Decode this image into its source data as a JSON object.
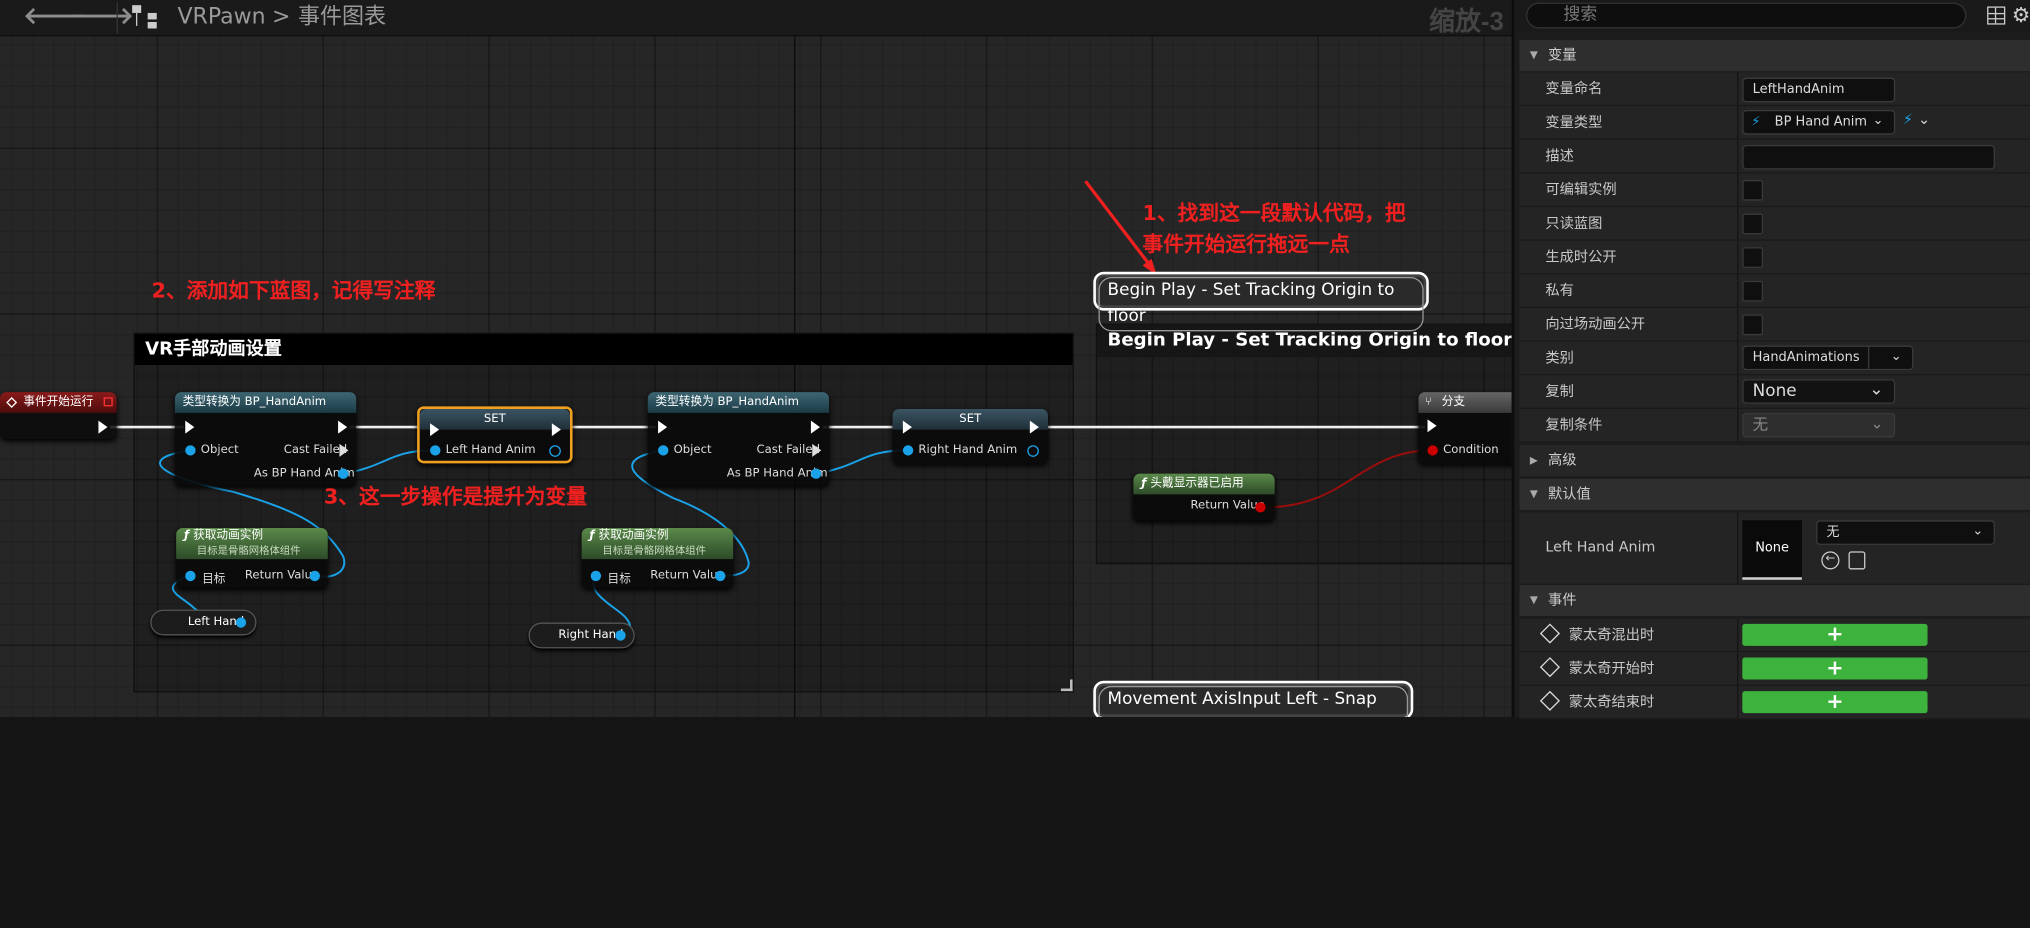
{
  "toolbar": {
    "back_icon": "left-arrow-icon",
    "forward_icon": "right-arrow-icon",
    "breadcrumb_root": "VRPawn",
    "breadcrumb_sep": ">",
    "breadcrumb_leaf": "事件图表",
    "zoom": "缩放-3"
  },
  "comments": {
    "hand_setup": "VR手部动画设置",
    "begin_play": "Begin Play - Set Tracking Origin to floor",
    "begin_play_bubble": "Begin Play - Set Tracking Origin to floor",
    "snap_turn_bubble": "Movement AxisInput Left - Snap Turn"
  },
  "nodes": {
    "event_begin": "事件开始运行",
    "cast1": {
      "title": "类型转换为 BP_HandAnim",
      "object": "Object",
      "cast_failed": "Cast Failed",
      "as": "As BP Hand Anim"
    },
    "set1": {
      "title": "SET",
      "pin": "Left Hand Anim"
    },
    "cast2": {
      "title": "类型转换为 BP_HandAnim",
      "object": "Object",
      "cast_failed": "Cast Failed",
      "as": "As BP Hand Anim"
    },
    "set2": {
      "title": "SET",
      "pin": "Right Hand Anim"
    },
    "func1": {
      "title": "获取动画实例",
      "subtitle": "目标是骨骼网格体组件",
      "target": "目标",
      "ret": "Return Value"
    },
    "func2": {
      "title": "获取动画实例",
      "subtitle": "目标是骨骼网格体组件",
      "target": "目标",
      "ret": "Return Value"
    },
    "left_hand": "Left Hand",
    "right_hand": "Right Hand",
    "hmd": {
      "title": "头戴显示器已启用",
      "ret": "Return Value"
    },
    "branch": {
      "title": "分支",
      "cond": "Condition"
    }
  },
  "annotations": {
    "a1_line1": "1、找到这一段默认代码，把",
    "a1_line2": "事件开始运行拖远一点",
    "a2": "2、添加如下蓝图，记得写注释",
    "a3": "3、这一步操作是提升为变量"
  },
  "panel": {
    "search_placeholder": "搜索",
    "sections": {
      "variables": "变量",
      "advanced": "高级",
      "defaults": "默认值",
      "events": "事件"
    },
    "rows": {
      "var_name": {
        "label": "变量命名",
        "value": "LeftHandAnim"
      },
      "var_type": {
        "label": "变量类型",
        "value": "BP Hand Anim"
      },
      "desc": {
        "label": "描述",
        "value": ""
      },
      "editable": {
        "label": "可编辑实例"
      },
      "readonly": {
        "label": "只读蓝图"
      },
      "expose_spawn": {
        "label": "生成时公开"
      },
      "private": {
        "label": "私有"
      },
      "expose_cine": {
        "label": "向过场动画公开"
      },
      "category": {
        "label": "类别",
        "value": "HandAnimations"
      },
      "replication": {
        "label": "复制",
        "value": "None"
      },
      "rep_cond": {
        "label": "复制条件",
        "value": "无"
      },
      "default_val": {
        "label": "Left Hand Anim",
        "thumb": "None",
        "value": "无"
      },
      "ev1": {
        "label": "蒙太奇混出时"
      },
      "ev2": {
        "label": "蒙太奇开始时"
      },
      "ev3": {
        "label": "蒙太奇结束时"
      }
    }
  }
}
